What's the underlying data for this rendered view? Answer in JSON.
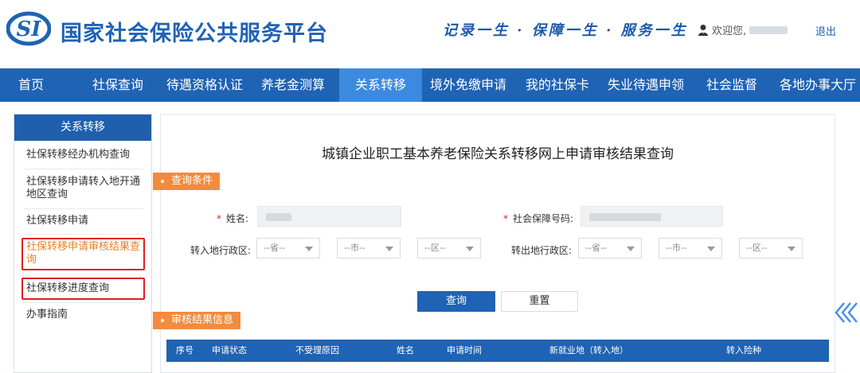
{
  "header": {
    "site_title": "国家社会保险公共服务平台",
    "slogan": "记录一生 · 保障一生 · 服务一生",
    "welcome": "欢迎您,",
    "logout": "退出"
  },
  "nav": {
    "items": [
      "首页",
      "社保查询",
      "待遇资格认证",
      "养老金测算",
      "关系转移",
      "境外免缴申请",
      "我的社保卡",
      "失业待遇申领",
      "社会监督",
      "各地办事大厅"
    ],
    "active": "关系转移"
  },
  "sidebar": {
    "title": "关系转移",
    "items": [
      "社保转移经办机构查询",
      "社保转移申请转入地开通地区查询",
      "社保转移申请",
      "社保转移申请审核结果查询",
      "社保转移进度查询",
      "办事指南"
    ]
  },
  "main": {
    "title": "城镇企业职工基本养老保险关系转移网上申请审核结果查询",
    "query_section": "查询条件",
    "result_section": "审核结果信息",
    "form": {
      "name_label": "姓名:",
      "ssn_label": "社会保障号码:",
      "transfer_in_label": "转入地行政区:",
      "transfer_out_label": "转出地行政区:",
      "province_placeholder": "--省--",
      "city_placeholder": "--市--",
      "district_placeholder": "--区--"
    },
    "buttons": {
      "query": "查询",
      "reset": "重置"
    },
    "table_columns": [
      "序号",
      "申请状态",
      "不受理原因",
      "姓名",
      "申请时间",
      "新就业地（转入地）",
      "转入险种"
    ]
  },
  "colors": {
    "brand_blue": "#1f63b4",
    "nav_active": "#3c8ae0",
    "section_orange": "#f28b3e",
    "highlight_red": "#e02020"
  }
}
